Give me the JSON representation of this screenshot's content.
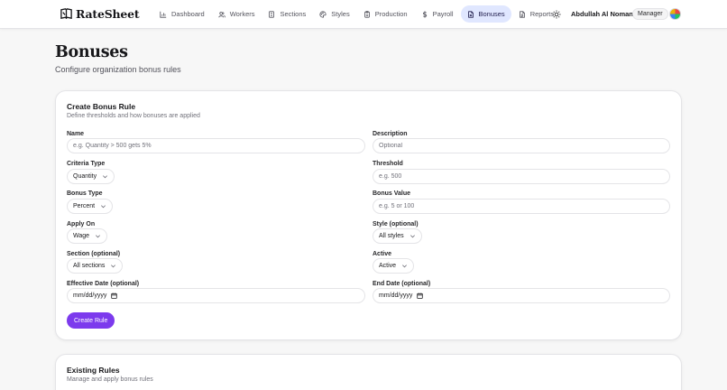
{
  "app": {
    "name": "RateSheet"
  },
  "nav": {
    "items": [
      {
        "label": "Dashboard",
        "icon": "bar-chart-icon"
      },
      {
        "label": "Workers",
        "icon": "users-icon"
      },
      {
        "label": "Sections",
        "icon": "building-icon"
      },
      {
        "label": "Styles",
        "icon": "palette-icon"
      },
      {
        "label": "Production",
        "icon": "clipboard-icon"
      },
      {
        "label": "Payroll",
        "icon": "dollar-icon"
      },
      {
        "label": "Bonuses",
        "icon": "file-icon",
        "active": true
      },
      {
        "label": "Reports",
        "icon": "file-text-icon"
      }
    ],
    "theme_icon": "sun-icon",
    "user_name": "Abdullah Al Noman",
    "separator": "·",
    "role": "Manager"
  },
  "page": {
    "title": "Bonuses",
    "subtitle": "Configure organization bonus rules"
  },
  "create_rule": {
    "title": "Create Bonus Rule",
    "description": "Define thresholds and how bonuses are applied",
    "fields": {
      "name": {
        "label": "Name",
        "placeholder": "e.g. Quantity > 500 gets 5%",
        "value": ""
      },
      "description": {
        "label": "Description",
        "placeholder": "Optional",
        "value": ""
      },
      "criteria_type": {
        "label": "Criteria Type",
        "value": "Quantity"
      },
      "threshold": {
        "label": "Threshold",
        "placeholder": "e.g. 500",
        "value": ""
      },
      "bonus_type": {
        "label": "Bonus Type",
        "value": "Percent"
      },
      "bonus_value": {
        "label": "Bonus Value",
        "placeholder": "e.g. 5 or 100",
        "value": ""
      },
      "apply_on": {
        "label": "Apply On",
        "value": "Wage"
      },
      "style": {
        "label": "Style (optional)",
        "value": "All styles"
      },
      "section": {
        "label": "Section (optional)",
        "value": "All sections"
      },
      "active": {
        "label": "Active",
        "value": "Active"
      },
      "effective_date": {
        "label": "Effective Date (optional)",
        "value": "mm/dd/yyyy"
      },
      "end_date": {
        "label": "End Date (optional)",
        "value": "mm/dd/yyyy"
      }
    },
    "submit_label": "Create Rule"
  },
  "existing_rules": {
    "title": "Existing Rules",
    "description": "Manage and apply bonus rules"
  },
  "colors": {
    "accent": "#7c3aed",
    "active_nav_bg": "#e0e7ff",
    "page_bg": "#f7f7f7"
  }
}
